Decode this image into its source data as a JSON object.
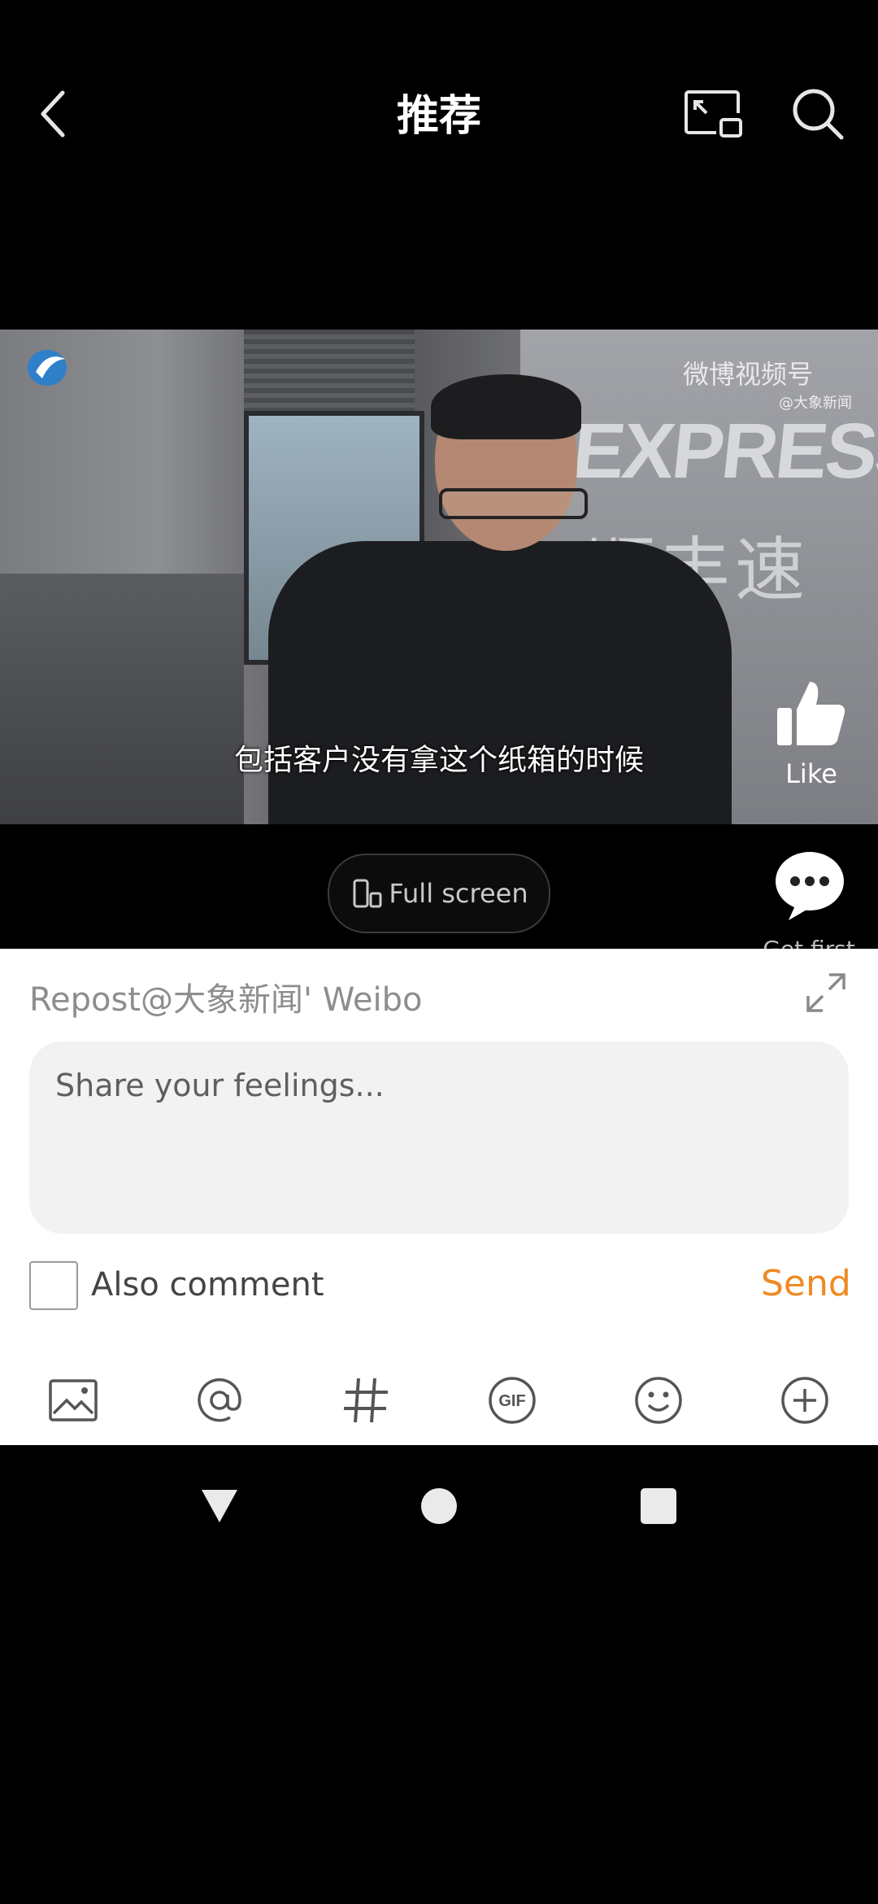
{
  "header": {
    "title": "推荐",
    "back_icon": "chevron-left-icon",
    "pip_icon": "picture-in-picture-icon",
    "search_icon": "search-icon"
  },
  "video": {
    "subtitle": "包括客户没有拿这个纸箱的时候",
    "watermark": "微博视频号",
    "watermark_handle": "@大象新闻",
    "sign_text": "EXPRESS",
    "sign_cn": "顺丰速运",
    "like_label": "Like",
    "full_screen_label": "Full screen",
    "comment_label": "Get first"
  },
  "repost_sheet": {
    "title": "Repost@大象新闻' Weibo",
    "input_placeholder": "Share your feelings...",
    "also_comment_label": "Also comment",
    "send_label": "Send",
    "tools": [
      "image-icon",
      "at-mention-icon",
      "hashtag-icon",
      "gif-icon",
      "emoji-icon",
      "plus-circle-icon"
    ]
  },
  "colors": {
    "accent": "#f08a24",
    "background": "#000000",
    "sheet": "#ffffff"
  }
}
